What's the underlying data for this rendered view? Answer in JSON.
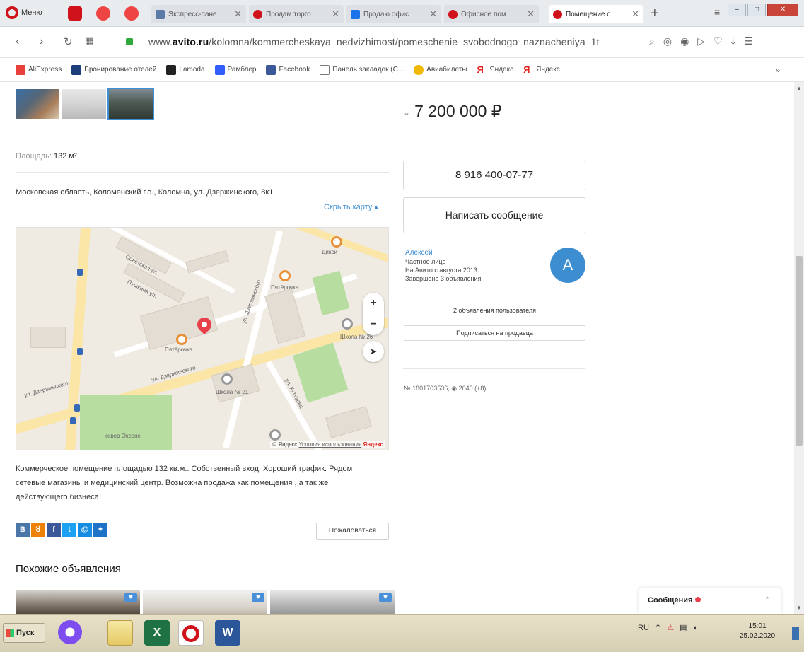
{
  "browser": {
    "menu_label": "Меню",
    "tabs": [
      {
        "title": "Экспресс-пане",
        "color": "#5b7aa8"
      },
      {
        "title": "Продам торго",
        "color": "#d0121b"
      },
      {
        "title": "Продаю офис",
        "color": "#1a73e8"
      },
      {
        "title": "Офисное пом",
        "color": "#d0121b"
      },
      {
        "title": "Помещение с",
        "color": "#d0121b"
      }
    ],
    "new_tab": "+",
    "url_prefix": "www.",
    "url_domain": "avito.ru",
    "url_path": "/kolomna/kommercheskaya_nedvizhimost/pomeschenie_svobodnogo_naznacheniya_1t",
    "bookmarks": [
      "AliExpress",
      "Бронирование отелей",
      "Lamoda",
      "Рамблер",
      "Facebook",
      "Панель закладок (С...",
      "Авиабилеты",
      "Яндекс",
      "Яндекс"
    ],
    "bookmarks_more": "»"
  },
  "listing": {
    "area_label": "Площадь:",
    "area_value": "132 м²",
    "address": "Московская область, Коломенский г.о., Коломна, ул. Дзержинского, 8к1",
    "hide_map": "Скрыть карту ▴",
    "description": "Коммерческое помещение площадью 132 кв.м.. Собственный вход. Хороший трафик. Рядом сетевые магазины и медицинский центр. Возможна продажа как помещения , а так же действующего бизнеса",
    "report_label": "Пожаловаться",
    "similar_title": "Похожие объявления",
    "price": "7 200 000 ₽",
    "phone": "8 916 400-07-77",
    "write_message": "Написать сообщение",
    "seller_name": "Алексей",
    "seller_type": "Частное лицо",
    "seller_since": "На Авито с августа 2013",
    "seller_completed": "Завершено 3 объявления",
    "avatar_letter": "А",
    "user_ads": "2 объявления пользователя",
    "subscribe": "Подписаться на продавца",
    "ad_id": "№ 1801703536, ◉ 2040 (+8)"
  },
  "map": {
    "labels": {
      "street1": "ул. Дзержинского",
      "street2": "ул. Дзержинского",
      "street3": "ул. Дзержинского",
      "street4": "ул. Кутузова",
      "shop1": "Пятёрочка",
      "shop2": "Пятёрочка",
      "shop3": "Дикси",
      "school1": "Школа № 21",
      "school2": "Школа № 26",
      "park": "сквер Оксонс",
      "str5": "Советская ул.",
      "str6": "Пушкина ул."
    },
    "zoom_in": "+",
    "zoom_out": "−",
    "geo": "➤",
    "copyright": "© Яндекс",
    "terms": "Условия использования",
    "brand": "Яндекс"
  },
  "messages_widget": {
    "label": "Сообщения",
    "chevron": "⌃"
  },
  "taskbar": {
    "start": "Пуск",
    "lang": "RU",
    "time": "15:01",
    "date": "25.02.2020"
  },
  "colors": {
    "accent": "#3d8ed1",
    "opera_red": "#d0121b",
    "avito_green": "#2fa83c"
  }
}
